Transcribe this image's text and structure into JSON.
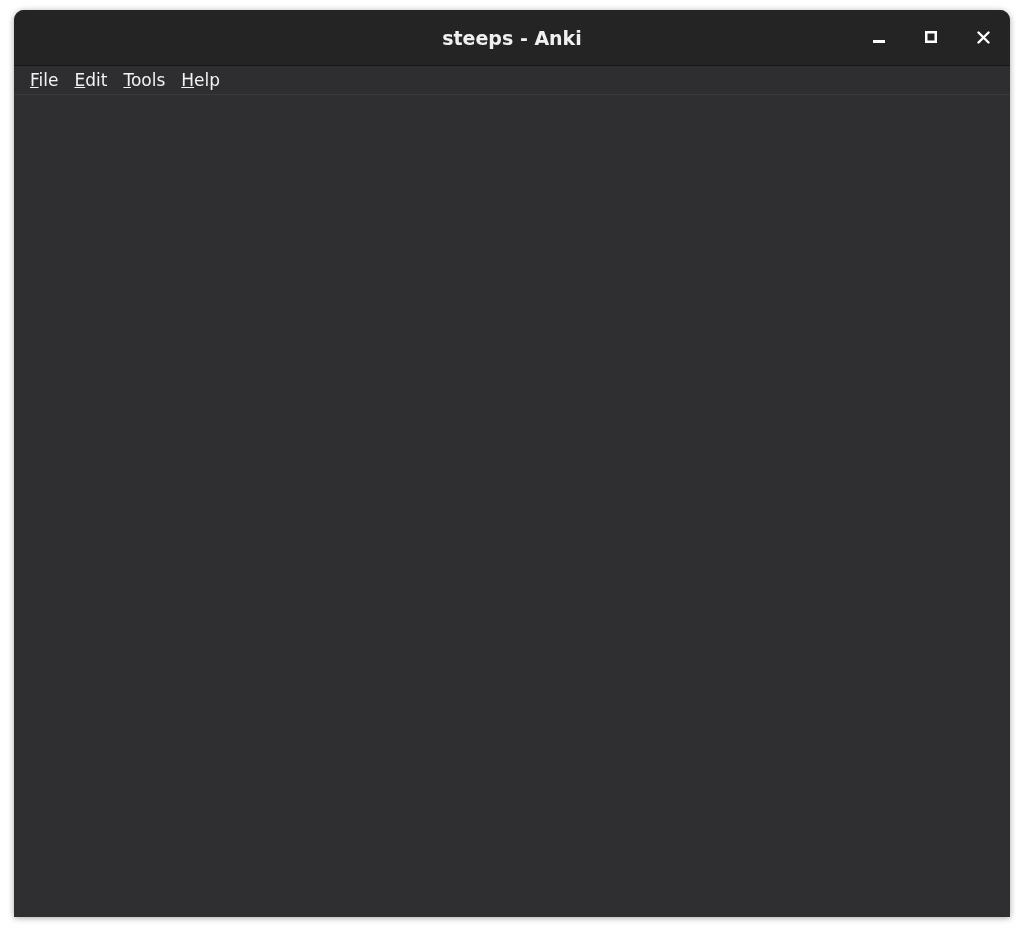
{
  "window": {
    "title": "steeps - Anki"
  },
  "menu": [
    {
      "label": "File"
    },
    {
      "label": "Edit"
    },
    {
      "label": "Tools"
    },
    {
      "label": "Help"
    }
  ]
}
